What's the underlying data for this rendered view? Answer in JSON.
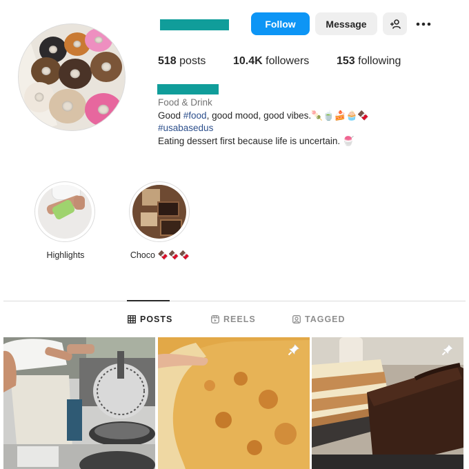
{
  "profile": {
    "follow_label": "Follow",
    "message_label": "Message",
    "stats": {
      "posts_count": "518",
      "posts_label": "posts",
      "followers_count": "10.4K",
      "followers_label": "followers",
      "following_count": "153",
      "following_label": "following"
    },
    "bio": {
      "category": "Food & Drink",
      "line1_prefix": "Good ",
      "line1_hashtag": "#food",
      "line1_suffix": ", good mood, good vibes.",
      "line1_emoji": "🍡🍵🍰🧁🍫",
      "hashtag_line": "#usabasedus",
      "line3_text": "Eating dessert first because life is uncertain. ",
      "line3_emoji": "🍧"
    }
  },
  "highlights": [
    {
      "label": "Highlights"
    },
    {
      "label": "Choco",
      "emoji": "🍫🍫🍫"
    }
  ],
  "tabs": [
    {
      "label": "POSTS",
      "icon": "grid-icon",
      "active": true
    },
    {
      "label": "REELS",
      "icon": "reels-icon",
      "active": false
    },
    {
      "label": "TAGGED",
      "icon": "tagged-icon",
      "active": false
    }
  ],
  "posts": [
    {
      "subject": "waffle making",
      "pinned": false
    },
    {
      "subject": "pizza",
      "pinned": true
    },
    {
      "subject": "cakes",
      "pinned": true
    }
  ],
  "colors": {
    "accent": "#0d95f5",
    "redacted": "#109d9a",
    "hashtag": "#2c4f8c"
  }
}
